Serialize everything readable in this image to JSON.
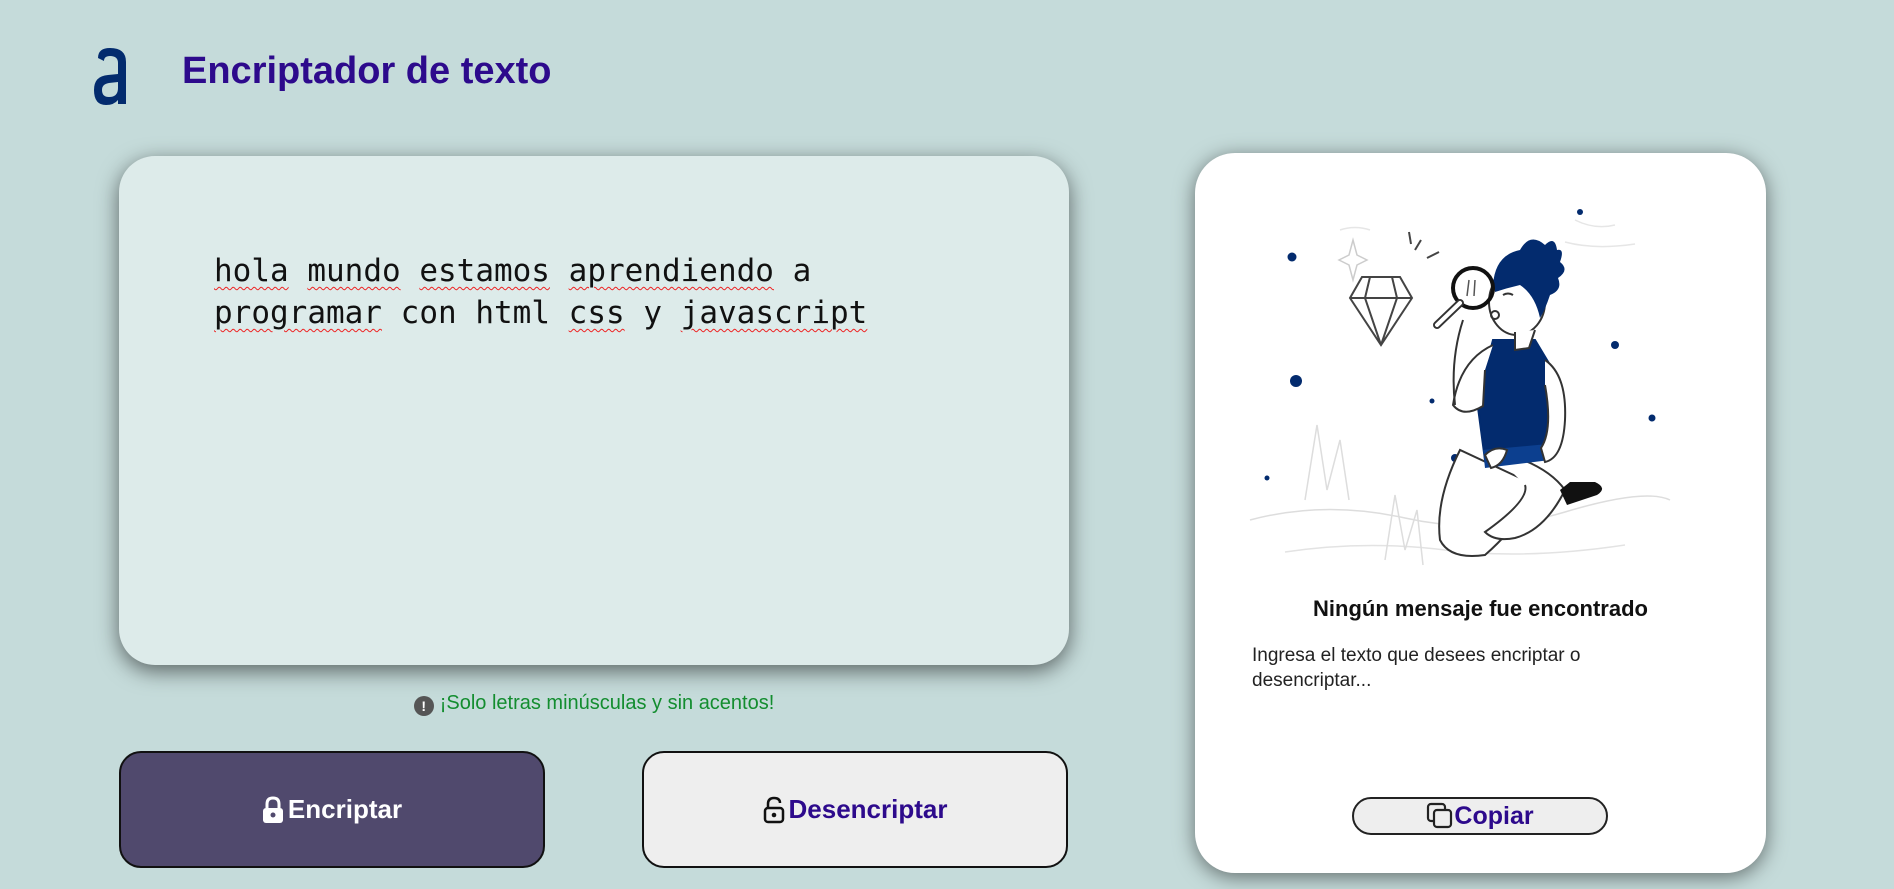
{
  "header": {
    "logo_icon": "alura-logo-icon",
    "title": "Encriptador de texto"
  },
  "input": {
    "words": [
      "hola",
      "mundo",
      "estamos",
      "aprendiendo",
      "a",
      "programar",
      "con",
      "html",
      "css",
      "y",
      "javascript"
    ]
  },
  "hint": {
    "icon": "exclamation-circle-icon",
    "text": "¡Solo letras minúsculas y sin acentos!"
  },
  "buttons": {
    "encrypt": {
      "icon": "lock-icon",
      "label": "Encriptar"
    },
    "decrypt": {
      "icon": "unlock-icon",
      "label": "Desencriptar"
    }
  },
  "output": {
    "illustration": "person-with-magnifying-glass-illustration",
    "title": "Ningún mensaje fue encontrado",
    "description": "Ingresa el texto que desees encriptar o desencriptar...",
    "copy_icon": "copy-icon",
    "copy_label": "Copiar"
  },
  "colors": {
    "background": "#c5dbda",
    "title": "#2d0a8c",
    "encrypt_button": "#50496d",
    "hint": "#138d2f",
    "accent_blue": "#032b6e"
  }
}
